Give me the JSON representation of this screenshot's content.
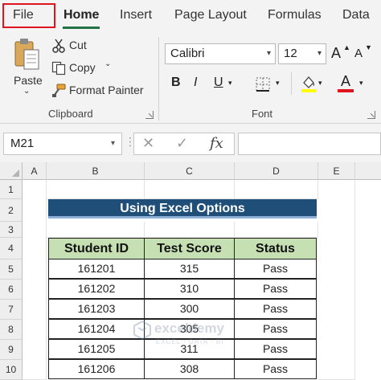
{
  "ribbon": {
    "tabs": [
      {
        "label": "File"
      },
      {
        "label": "Home"
      },
      {
        "label": "Insert"
      },
      {
        "label": "Page Layout"
      },
      {
        "label": "Formulas"
      },
      {
        "label": "Data"
      }
    ],
    "active_tab": "Home",
    "highlight_color": "#e0141e",
    "accent_color": "#217346",
    "clipboard": {
      "paste_label": "Paste",
      "cut_label": "Cut",
      "copy_label": "Copy",
      "format_painter_label": "Format Painter",
      "group_label": "Clipboard"
    },
    "font": {
      "font_name": "Calibri",
      "font_size": "12",
      "grow_label": "A",
      "shrink_label": "A",
      "bold_label": "B",
      "italic_label": "I",
      "underline_label": "U",
      "font_color_label": "A",
      "font_color": "#e0141e",
      "fill_color": "#ffff00",
      "group_label": "Font"
    }
  },
  "formula_bar": {
    "name_box": "M21",
    "cancel_symbol": "✕",
    "enter_symbol": "✓",
    "fx_symbol": "fx",
    "formula": ""
  },
  "grid": {
    "columns": [
      "A",
      "B",
      "C",
      "D",
      "E"
    ],
    "rows": [
      "1",
      "2",
      "3",
      "4",
      "5",
      "6",
      "7",
      "8",
      "9",
      "10"
    ]
  },
  "sheet": {
    "title": "Using Excel Options",
    "title_bg": "#1f4e79",
    "header_bg": "#c6e0b4",
    "headers": [
      "Student ID",
      "Test Score",
      "Status"
    ],
    "rows": [
      [
        "161201",
        "315",
        "Pass"
      ],
      [
        "161202",
        "310",
        "Pass"
      ],
      [
        "161203",
        "300",
        "Pass"
      ],
      [
        "161204",
        "305",
        "Pass"
      ],
      [
        "161205",
        "311",
        "Pass"
      ],
      [
        "161206",
        "308",
        "Pass"
      ]
    ]
  },
  "watermark": {
    "title": "exceldemy",
    "subtitle": "EXCEL · DATA · BI"
  }
}
